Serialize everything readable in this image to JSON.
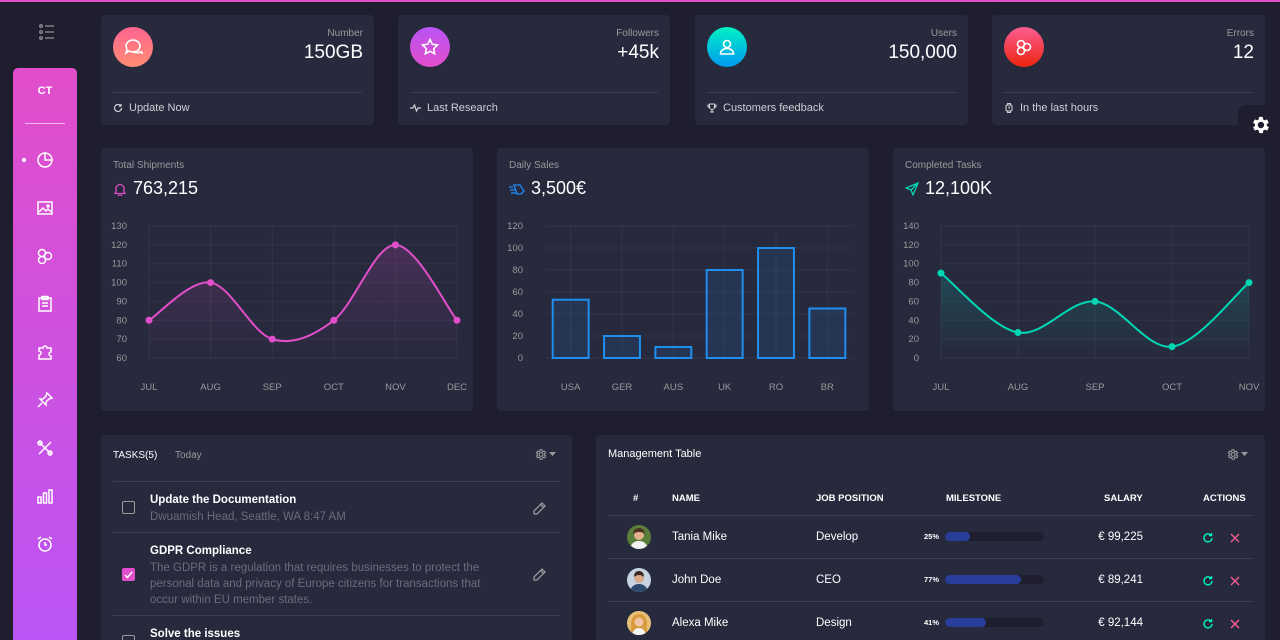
{
  "brand": {
    "logo": "CT"
  },
  "colors": {
    "primary": "#e14eca",
    "info": "#1d8cf8",
    "success": "#00f2c3",
    "danger": "#fd5d93"
  },
  "stats": [
    {
      "category": "Number",
      "value": "150GB",
      "footer": "Update Now",
      "icon": "chat-icon",
      "footer_icon": "refresh-icon"
    },
    {
      "category": "Followers",
      "value": "+45k",
      "footer": "Last Research",
      "icon": "star-icon",
      "footer_icon": "pulse-icon"
    },
    {
      "category": "Users",
      "value": "150,000",
      "footer": "Customers feedback",
      "icon": "user-icon",
      "footer_icon": "trophy-icon"
    },
    {
      "category": "Errors",
      "value": "12",
      "footer": "In the last hours",
      "icon": "molecule-icon",
      "footer_icon": "watch-icon"
    }
  ],
  "charts": [
    {
      "category": "Total Shipments",
      "value": "763,215",
      "icon": "bell-icon"
    },
    {
      "category": "Daily Sales",
      "value": "3,500€",
      "icon": "delivery-icon"
    },
    {
      "category": "Completed Tasks",
      "value": "12,100K",
      "icon": "send-icon"
    }
  ],
  "chart_data": [
    {
      "type": "line",
      "categories": [
        "JUL",
        "AUG",
        "SEP",
        "OCT",
        "NOV",
        "DEC"
      ],
      "values": [
        80,
        100,
        70,
        80,
        120,
        80
      ],
      "ylim": [
        60,
        130
      ],
      "yticks": [
        60,
        70,
        80,
        90,
        100,
        110,
        120,
        130
      ],
      "color": "#e14eca",
      "grid": true
    },
    {
      "type": "bar",
      "categories": [
        "USA",
        "GER",
        "AUS",
        "UK",
        "RO",
        "BR"
      ],
      "values": [
        53,
        20,
        10,
        80,
        100,
        45
      ],
      "ylim": [
        0,
        120
      ],
      "yticks": [
        0,
        20,
        40,
        60,
        80,
        100,
        120
      ],
      "color": "#1f8ef1",
      "grid": true
    },
    {
      "type": "line",
      "categories": [
        "JUL",
        "AUG",
        "SEP",
        "OCT",
        "NOV"
      ],
      "values": [
        90,
        27,
        60,
        12,
        80
      ],
      "ylim": [
        0,
        140
      ],
      "yticks": [
        0,
        20,
        40,
        60,
        80,
        100,
        120,
        140
      ],
      "color": "#00d6b4",
      "grid": true
    }
  ],
  "tasks": {
    "title": "TASKS(5)",
    "today": "Today",
    "items": [
      {
        "title": "Update the Documentation",
        "desc": "Dwuamish Head, Seattle, WA 8:47 AM",
        "checked": false
      },
      {
        "title": "GDPR Compliance",
        "desc": "The GDPR is a regulation that requires businesses to protect the personal data and privacy of Europe citizens for transactions that occur within EU member states.",
        "checked": true
      },
      {
        "title": "Solve the issues",
        "desc": "",
        "checked": false
      }
    ]
  },
  "table": {
    "title": "Management Table",
    "headers": [
      "#",
      "NAME",
      "JOB POSITION",
      "MILESTONE",
      "SALARY",
      "ACTIONS"
    ],
    "rows": [
      {
        "name": "Tania Mike",
        "job": "Develop",
        "pct": "25%",
        "progress": 0.25,
        "salary": "€ 99,225"
      },
      {
        "name": "John Doe",
        "job": "CEO",
        "pct": "77%",
        "progress": 0.77,
        "salary": "€ 89,241"
      },
      {
        "name": "Alexa Mike",
        "job": "Design",
        "pct": "41%",
        "progress": 0.41,
        "salary": "€ 92,144"
      }
    ]
  }
}
